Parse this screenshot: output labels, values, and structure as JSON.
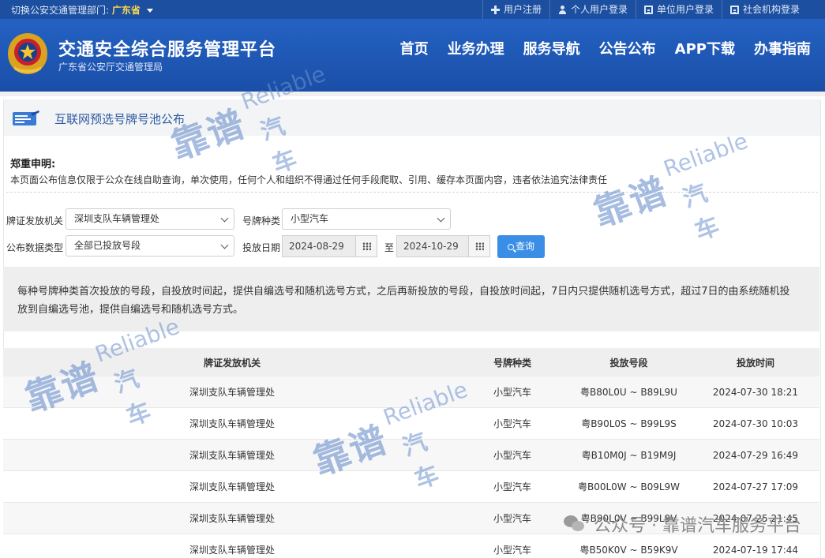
{
  "topbar": {
    "switch_label": "切换公安交通管理部门:",
    "province": "广东省",
    "links": [
      {
        "label": "用户注册",
        "icon": "plus-icon"
      },
      {
        "label": "个人用户登录",
        "icon": "user-icon"
      },
      {
        "label": "单位用户登录",
        "icon": "building-icon"
      },
      {
        "label": "社会机构登录",
        "icon": "document-icon"
      }
    ]
  },
  "header": {
    "title": "交通安全综合服务管理平台",
    "subtitle": "广东省公安厅交通管理局",
    "nav": [
      "首页",
      "业务办理",
      "服务导航",
      "公告公布",
      "APP下载",
      "办事指南"
    ]
  },
  "section": {
    "title": "互联网预选号牌号池公布"
  },
  "declaration": {
    "title": "郑重申明:",
    "text": "本页面公布信息仅限于公众在线自助查询，单次使用，任何个人和组织不得通过任何手段爬取、引用、缓存本页面内容，违者依法追究法律责任"
  },
  "form": {
    "issuer_label": "牌证发放机关",
    "issuer_value": "深圳支队车辆管理处",
    "plate_type_label": "号牌种类",
    "plate_type_value": "小型汽车",
    "data_type_label": "公布数据类型",
    "data_type_value": "全部已投放号段",
    "date_label": "投放日期",
    "date_from": "2024-08-29",
    "date_to_label": "至",
    "date_to": "2024-10-29",
    "query_label": "查询"
  },
  "notice": {
    "text": "每种号牌种类首次投放的号段，自投放时间起，提供自编选号和随机选号方式，之后再新投放的号段，自投放时间起，7日内只提供随机选号方式，超过7日的由系统随机投放到自编选号池，提供自编选号和随机选号方式。"
  },
  "table": {
    "headers": [
      "牌证发放机关",
      "号牌种类",
      "投放号段",
      "投放时间"
    ],
    "rows": [
      [
        "深圳支队车辆管理处",
        "小型汽车",
        "粤B80L0U ~ B89L9U",
        "2024-07-30 18:21"
      ],
      [
        "深圳支队车辆管理处",
        "小型汽车",
        "粤B90L0S ~ B99L9S",
        "2024-07-30 10:03"
      ],
      [
        "深圳支队车辆管理处",
        "小型汽车",
        "粤B10M0J ~ B19M9J",
        "2024-07-29 16:49"
      ],
      [
        "深圳支队车辆管理处",
        "小型汽车",
        "粤B00L0W ~ B09L9W",
        "2024-07-27 17:09"
      ],
      [
        "深圳支队车辆管理处",
        "小型汽车",
        "粤B90L0V ~ B99L9V",
        "2024-07-25 21:45"
      ],
      [
        "深圳支队车辆管理处",
        "小型汽车",
        "粤B50K0V ~ B59K9V",
        "2024-07-19 17:44"
      ]
    ]
  },
  "watermark": {
    "brand_cn": "靠谱",
    "brand_en": "Reliable",
    "brand_car": "汽车",
    "footer": "公众号 · 靠谱汽车服务平台"
  },
  "colors": {
    "header_blue": "#1d55b3",
    "query_button": "#3a8ee6",
    "province_yellow": "#ffd84a"
  }
}
